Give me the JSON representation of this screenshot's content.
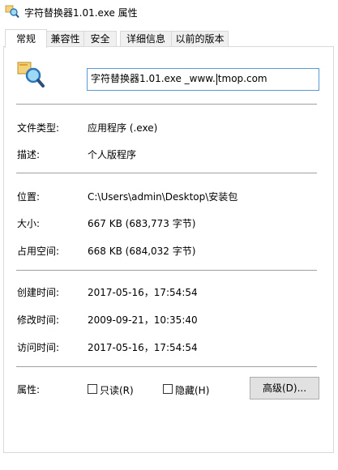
{
  "window": {
    "title": "字符替换器1.01.exe 属性"
  },
  "tabs": [
    {
      "label": "常规"
    },
    {
      "label": "兼容性"
    },
    {
      "label": "安全"
    },
    {
      "label": "详细信息"
    },
    {
      "label": "以前的版本"
    }
  ],
  "file": {
    "name_before_caret": "字符替换器1.01.exe _www.",
    "name_after_caret": "tmop.com"
  },
  "labels": {
    "type": "文件类型:",
    "description": "描述:",
    "location": "位置:",
    "size": "大小:",
    "size_on_disk": "占用空间:",
    "created": "创建时间:",
    "modified": "修改时间:",
    "accessed": "访问时间:",
    "attributes": "属性:"
  },
  "values": {
    "type": "应用程序 (.exe)",
    "description": "个人版程序",
    "location": "C:\\Users\\admin\\Desktop\\安装包",
    "size": "667 KB (683,773 字节)",
    "size_on_disk": "668 KB (684,032 字节)",
    "created": "2017-05-16，17:54:54",
    "modified": "2009-09-21，10:35:40",
    "accessed": "2017-05-16，17:54:54"
  },
  "attributes": {
    "readonly": "只读(R)",
    "hidden": "隐藏(H)",
    "advanced": "高级(D)..."
  },
  "colors": {
    "focus_border": "#5b9bd5",
    "separator": "#a0a0a0",
    "button_bg": "#e1e1e1"
  }
}
